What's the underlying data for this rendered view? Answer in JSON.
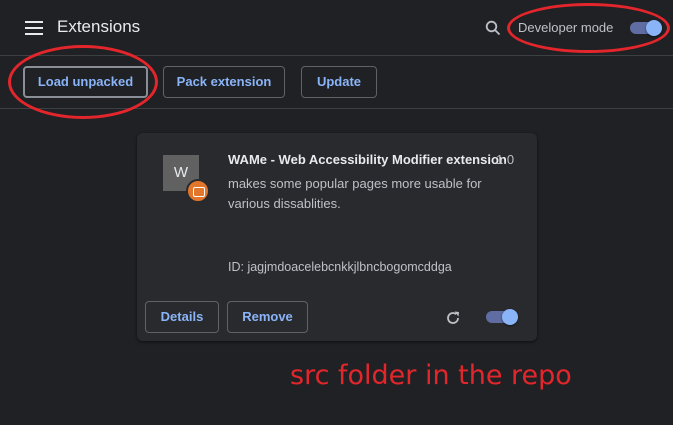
{
  "header": {
    "title": "Extensions",
    "dev_mode_label": "Developer mode",
    "dev_mode_enabled": true
  },
  "toolbar": {
    "load_unpacked": "Load unpacked",
    "pack_extension": "Pack extension",
    "update": "Update"
  },
  "extension": {
    "icon_letter": "W",
    "name": "WAMe - Web Accessibility Modifier extension",
    "version": "1.0",
    "description": "makes some popular pages more usable for various dissablities.",
    "id_text": "ID: jagjmdoacelebcnkkjlbncbogomcddga",
    "details_label": "Details",
    "remove_label": "Remove",
    "enabled": true
  },
  "annotation": {
    "text": "src folder in the repo",
    "color": "#e3262c"
  },
  "colors": {
    "background": "#202124",
    "card": "#292a2d",
    "accent": "#8ab4f8"
  }
}
